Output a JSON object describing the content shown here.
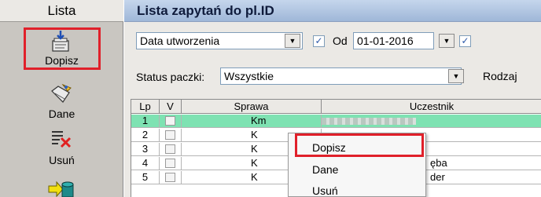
{
  "sidebar": {
    "header": "Lista",
    "buttons": [
      {
        "label": "Dopisz",
        "icon": "add-document-icon"
      },
      {
        "label": "Dane",
        "icon": "edit-document-icon"
      },
      {
        "label": "Usuń",
        "icon": "delete-list-icon"
      },
      {
        "label": "",
        "icon": "arrow-database-icon"
      }
    ]
  },
  "main": {
    "title": "Lista zapytań do pl.ID",
    "date_filter": {
      "field": "Data utworzenia",
      "od_checked": true,
      "od_label": "Od",
      "od_value": "01-01-2016"
    },
    "status_filter": {
      "label": "Status paczki:",
      "value": "Wszystkie",
      "rodzaj_label": "Rodzaj"
    }
  },
  "table": {
    "columns": [
      "Lp",
      "V",
      "Sprawa",
      "Uczestnik"
    ],
    "rows": [
      {
        "lp": "1",
        "sprawa": "Km",
        "uczestnik": "",
        "selected": true
      },
      {
        "lp": "2",
        "sprawa": "K",
        "uczestnik": "",
        "selected": false
      },
      {
        "lp": "3",
        "sprawa": "K",
        "uczestnik": "",
        "selected": false
      },
      {
        "lp": "4",
        "sprawa": "K",
        "uczestnik": "ęba",
        "selected": false
      },
      {
        "lp": "5",
        "sprawa": "K",
        "uczestnik": "der",
        "selected": false
      }
    ]
  },
  "context_menu": {
    "items": [
      "Dopisz",
      "Dane",
      "Usuń"
    ]
  },
  "colors": {
    "highlight": "#e0202a",
    "selected_row": "#7ee2b2",
    "title_bar": "#b3c7e3"
  }
}
